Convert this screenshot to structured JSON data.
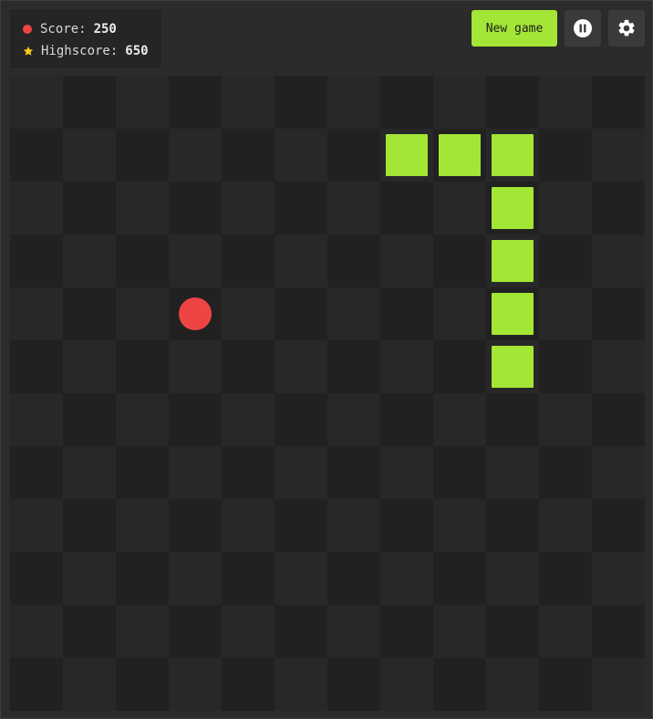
{
  "scoreboard": {
    "score_label": "Score:",
    "score_value": "250",
    "highscore_label": "Highscore:",
    "highscore_value": "650",
    "score_icon": "red-dot-icon",
    "highscore_icon": "star-icon"
  },
  "controls": {
    "new_game_label": "New game",
    "pause_icon": "pause-icon",
    "settings_icon": "gear-icon"
  },
  "board": {
    "columns": 12,
    "rows": 12,
    "snake": [
      [
        9,
        5
      ],
      [
        9,
        4
      ],
      [
        9,
        3
      ],
      [
        9,
        2
      ],
      [
        9,
        1
      ],
      [
        8,
        1
      ],
      [
        7,
        1
      ]
    ],
    "food": [
      3,
      4
    ]
  },
  "colors": {
    "accent": "#a3e635",
    "food": "#ef4444",
    "star": "#facc15"
  }
}
